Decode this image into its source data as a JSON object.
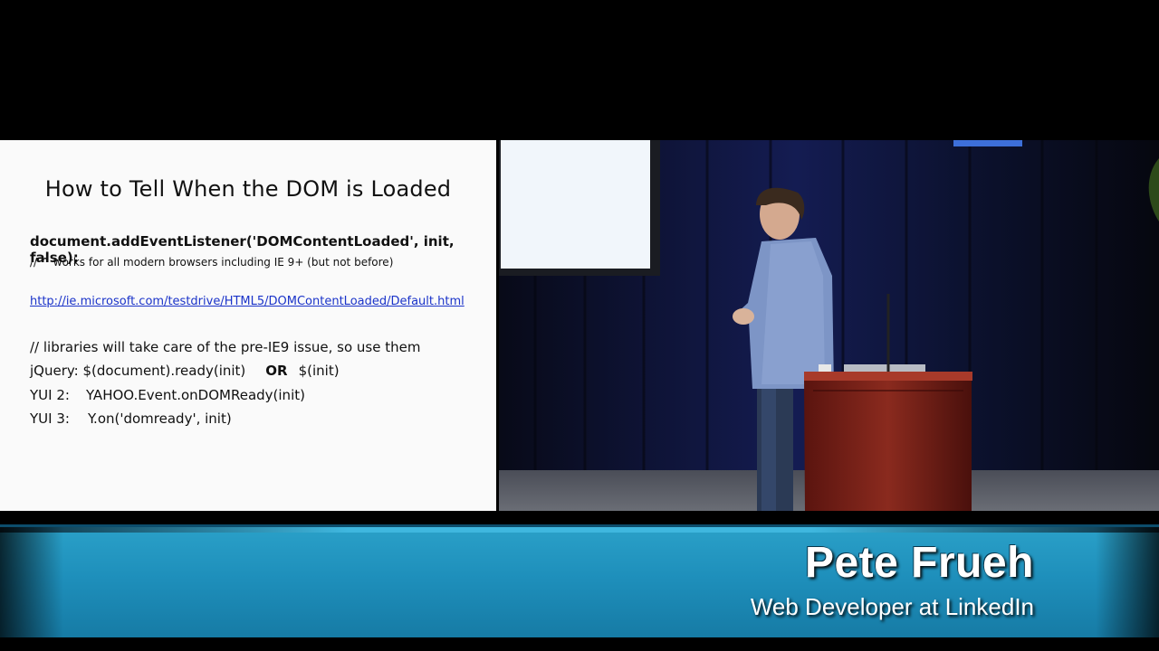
{
  "slide": {
    "title": "How to Tell When the DOM is Loaded",
    "code_main": "document.addEventListener('DOMContentLoaded', init, false);",
    "code_comment": "// ^ works for all modern browsers including IE 9+ (but not before)",
    "link": "http://ie.microsoft.com/testdrive/HTML5/DOMContentLoaded/Default.html",
    "line1": "// libraries will take care of the pre-IE9 issue, so use them",
    "jquery_a": "jQuery: $(document).ready(init)",
    "jquery_or": "OR",
    "jquery_b": "$(init)",
    "yui2_label": "YUI 2:",
    "yui2_code": "YAHOO.Event.onDOMReady(init)",
    "yui3_label": "YUI 3:",
    "yui3_code": "Y.on('domready', init)"
  },
  "lower_third": {
    "name": "Pete Frueh",
    "title": "Web Developer at LinkedIn"
  },
  "colors": {
    "banner": "#1e8fbb",
    "link": "#1a33c9",
    "curtain": "#0c1230",
    "podium": "#7a1f16"
  }
}
